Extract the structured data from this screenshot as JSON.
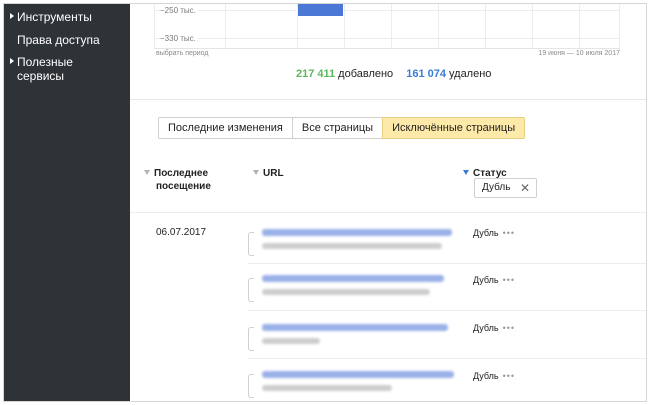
{
  "sidebar": {
    "items": [
      {
        "label": "Инструменты",
        "expandable": true
      },
      {
        "label": "Права доступа",
        "expandable": false
      },
      {
        "label": "Полезные сервисы",
        "line1": "Полезные",
        "line2": "сервисы",
        "expandable": true
      }
    ]
  },
  "chart": {
    "y_ticks": [
      "−250 тыс.",
      "−330 тыс."
    ],
    "select_period": "выбрать период",
    "date_range": "19 июня — 10 июля 2017",
    "bar_color": "#4a78d4"
  },
  "stats": {
    "added_count": "217 411",
    "added_label": "добавлено",
    "removed_count": "161 074",
    "removed_label": "удалено",
    "added_color": "#5cb85c",
    "removed_color": "#3a7bd5"
  },
  "tabs": [
    {
      "label": "Последние изменения",
      "active": false
    },
    {
      "label": "Все страницы",
      "active": false
    },
    {
      "label": "Исключённые страницы",
      "active": true
    }
  ],
  "table": {
    "columns": {
      "last_visit_line1": "Последнее",
      "last_visit_line2": "посещение",
      "url": "URL",
      "status": "Статус"
    },
    "status_filter": {
      "value": "Дубль",
      "clear_icon": "close-icon"
    },
    "date": "06.07.2017",
    "rows": [
      {
        "status": "Дубль",
        "more": "•••"
      },
      {
        "status": "Дубль",
        "more": "•••"
      },
      {
        "status": "Дубль",
        "more": "•••"
      },
      {
        "status": "Дубль",
        "more": "•••"
      }
    ]
  }
}
